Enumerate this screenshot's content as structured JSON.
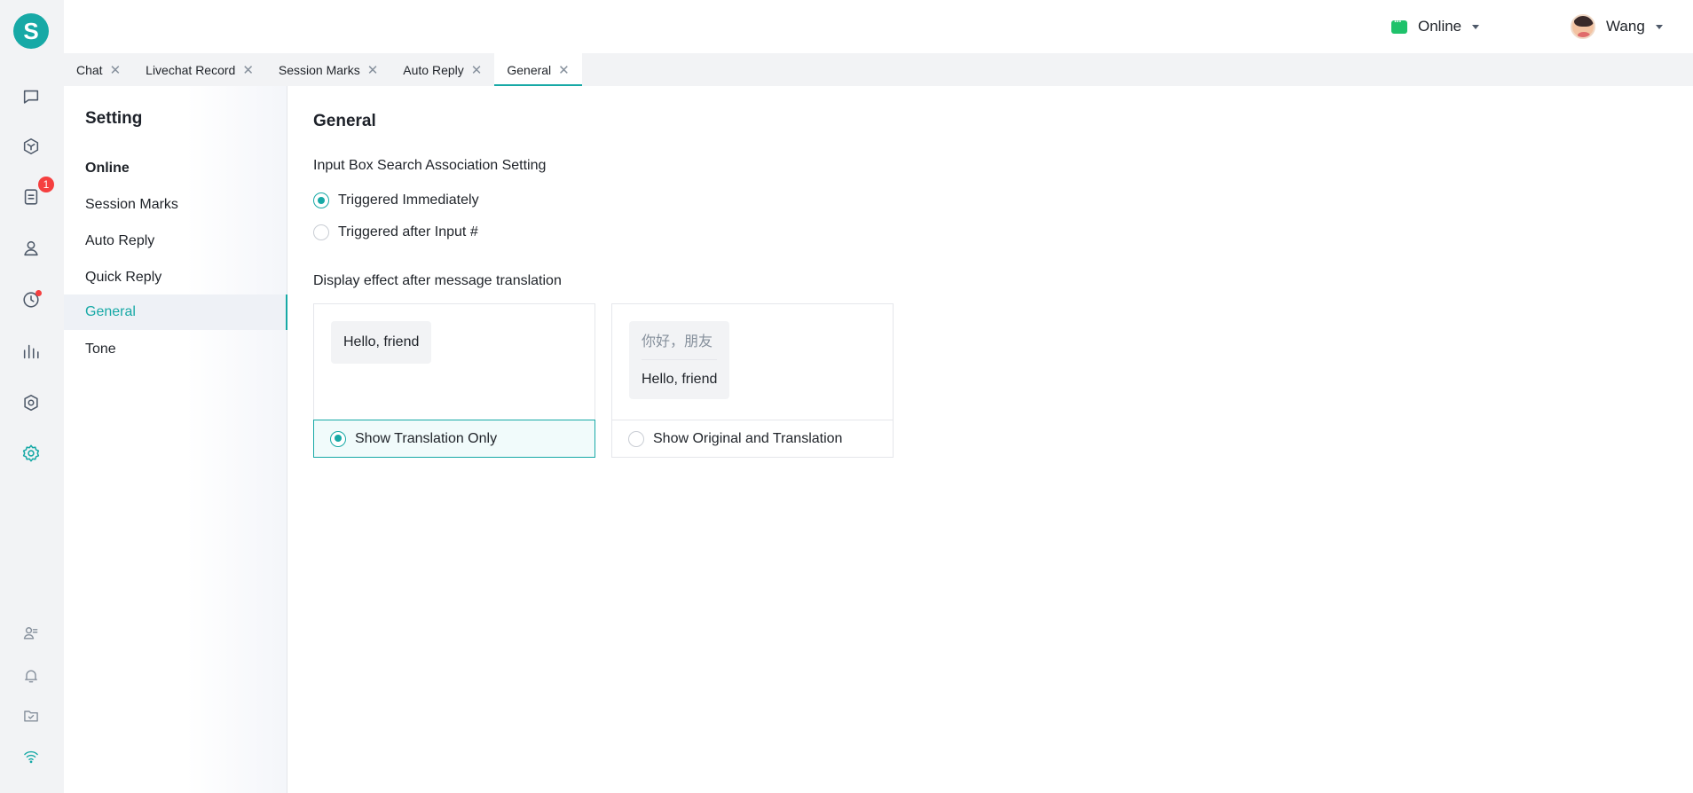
{
  "app": {
    "logo_letter": "S"
  },
  "rail": {
    "badge_count": "1",
    "icons": [
      "chat-icon",
      "cube-icon",
      "document-icon",
      "contacts-icon",
      "history-icon",
      "stats-icon",
      "security-icon",
      "settings-icon",
      "agent-icon",
      "bell-icon",
      "folder-check-icon",
      "wifi-icon"
    ]
  },
  "header": {
    "status_label": "Online",
    "status_color": "#1fc26b",
    "user_name": "Wang"
  },
  "tabs": [
    {
      "label": "Chat"
    },
    {
      "label": "Livechat Record"
    },
    {
      "label": "Session Marks"
    },
    {
      "label": "Auto Reply"
    },
    {
      "label": "General",
      "active": true
    }
  ],
  "tab_close_glyph": "✕",
  "sidebar": {
    "title": "Setting",
    "items": [
      {
        "label": "Online"
      },
      {
        "label": "Session Marks"
      },
      {
        "label": "Auto Reply"
      },
      {
        "label": "Quick Reply"
      },
      {
        "label": "General",
        "active": true
      },
      {
        "label": "Tone"
      }
    ]
  },
  "main": {
    "title": "General",
    "search_setting": {
      "label": "Input Box Search Association Setting",
      "options": [
        {
          "label": "Triggered Immediately",
          "selected": true
        },
        {
          "label": "Triggered after Input #",
          "selected": false
        }
      ]
    },
    "translation_setting": {
      "label": "Display effect after message translation",
      "cards": [
        {
          "preview_translation": "Hello, friend",
          "option_label": "Show Translation Only",
          "selected": true
        },
        {
          "preview_original": "你好，朋友",
          "preview_translation": "Hello, friend",
          "option_label": "Show Original and Translation",
          "selected": false
        }
      ]
    }
  },
  "colors": {
    "accent": "#17a9a6",
    "badge": "#f53f3f"
  }
}
